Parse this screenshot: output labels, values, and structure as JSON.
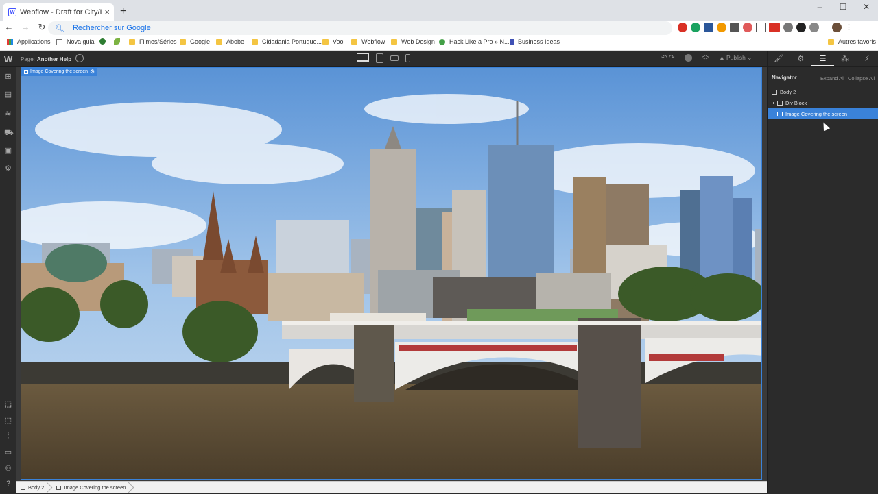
{
  "browser": {
    "tab_title": "Webflow - Draft for City/Image",
    "tab_close": "×",
    "new_tab": "+",
    "window_controls": [
      "–",
      "☐",
      "✕"
    ],
    "omnibox_placeholder": "Rechercher sur Google"
  },
  "bookmarks": {
    "items": [
      "Applications",
      "Nova guia",
      "Filmes/Séries",
      "Google",
      "Abobe",
      "Cidadania Portugue...",
      "Voo",
      "Webflow",
      "Web Design",
      "Hack Like a Pro » N...",
      "Business Ideas"
    ],
    "other": "Autres favoris"
  },
  "designer": {
    "page_label": "Page:",
    "page_name": "Another Help",
    "publish_label": "Publish"
  },
  "navigator": {
    "title": "Navigator",
    "expand_all": "Expand All",
    "collapse_all": "Collapse All",
    "tree": [
      {
        "label": "Body 2",
        "selected": false
      },
      {
        "label": "Div Block",
        "selected": false
      },
      {
        "label": "Image Covering the screen",
        "selected": true
      }
    ]
  },
  "canvas": {
    "selected_element_label": "Image Covering the screen"
  },
  "breadcrumb": [
    "Body 2",
    "Image Covering the screen"
  ],
  "colors": {
    "selection_blue": "#3a82d9",
    "designer_bg": "#2b2b2b"
  }
}
